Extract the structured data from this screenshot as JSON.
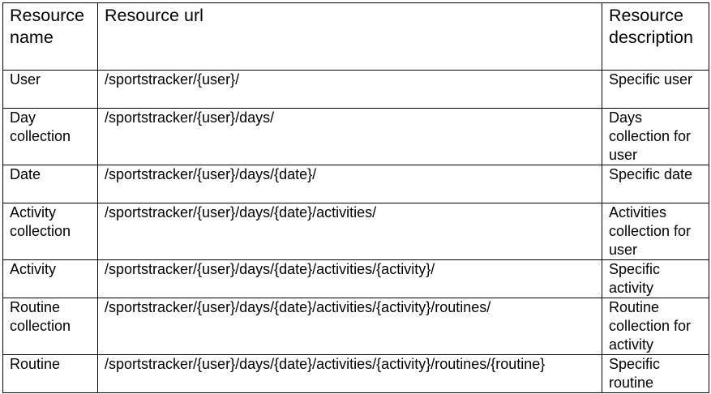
{
  "table": {
    "headers": [
      "Resource name",
      "Resource url",
      "Resource description"
    ],
    "rows": [
      {
        "name": "User",
        "url": "/sportstracker/{user}/",
        "description": "Specific user"
      },
      {
        "name": "Day collection",
        "url": "/sportstracker/{user}/days/",
        "description": "Days collection for user"
      },
      {
        "name": "Date",
        "url": "/sportstracker/{user}/days/{date}/",
        "description": "Specific date"
      },
      {
        "name": "Activity collection",
        "url": "/sportstracker/{user}/days/{date}/activities/",
        "description": "Activities collection for user"
      },
      {
        "name": "Activity",
        "url": "/sportstracker/{user}/days/{date}/activities/{activity}/",
        "description": "Specific activity"
      },
      {
        "name": "Routine collection",
        "url": "/sportstracker/{user}/days/{date}/activities/{activity}/routines/",
        "description": "Routine collection for activity"
      },
      {
        "name": "Routine",
        "url": "/sportstracker/{user}/days/{date}/activities/{activity}/routines/{routine}",
        "description": "Specific routine"
      }
    ]
  }
}
